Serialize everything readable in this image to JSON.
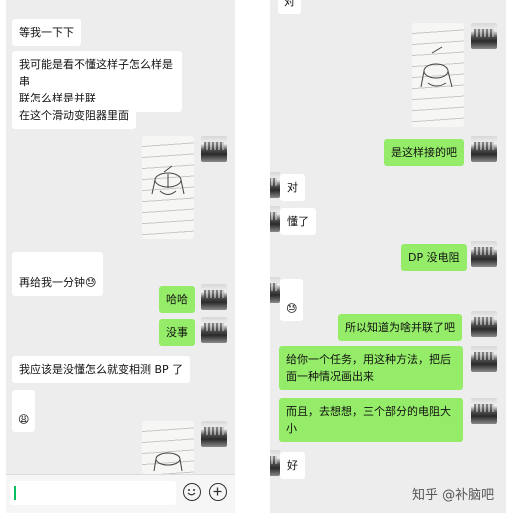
{
  "left_chat": {
    "messages": [
      {
        "side": "in",
        "text": "等我一下下"
      },
      {
        "side": "in",
        "text": "我可能是看不懂这样子怎么样是串\n联怎么样是并联"
      },
      {
        "side": "in",
        "text": "在这个滑动变阻器里面"
      },
      {
        "side": "out",
        "type": "photo",
        "content": "hand-drawn circuit sketch photo"
      },
      {
        "side": "in",
        "text": "再给我一分钟",
        "emoji": "😓"
      },
      {
        "side": "out",
        "text": "哈哈"
      },
      {
        "side": "out",
        "text": "没事"
      },
      {
        "side": "in",
        "text": "我应该是没懂怎么就变相测 BP 了"
      },
      {
        "side": "in",
        "type": "emoji",
        "emoji": "😩"
      },
      {
        "side": "out",
        "type": "photo",
        "content": "hand-drawn circuit sketch photo"
      }
    ],
    "input": {
      "value": "",
      "smiley_icon": "smiley-icon",
      "plus_icon": "plus-icon"
    }
  },
  "right_chat": {
    "top_partial_text": "对",
    "messages": [
      {
        "side": "out",
        "type": "photo",
        "content": "hand-drawn circuit sketch photo"
      },
      {
        "side": "out",
        "text": "是这样接的吧"
      },
      {
        "side": "in",
        "text": "对"
      },
      {
        "side": "in",
        "text": "懂了"
      },
      {
        "side": "out",
        "text": "DP 没电阻"
      },
      {
        "side": "in",
        "type": "emoji",
        "emoji": "😓"
      },
      {
        "side": "out",
        "text": "所以知道为啥并联了吧"
      },
      {
        "side": "out",
        "text": "给你一个任务，用这种方法，把后\n面一种情况画出来"
      },
      {
        "side": "out",
        "text": "而且，去想想，三个部分的电阻大\n小"
      },
      {
        "side": "in",
        "text": "好"
      }
    ]
  },
  "watermark": {
    "text": "知乎 @补脑吧"
  }
}
